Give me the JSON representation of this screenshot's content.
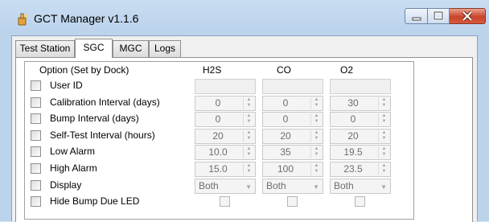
{
  "window": {
    "title": "GCT Manager v1.1.6"
  },
  "tabs": [
    "Test Station",
    "SGC",
    "MGC",
    "Logs"
  ],
  "active_tab": "SGC",
  "table": {
    "option_header": "Option (Set by Dock)",
    "columns": [
      "H2S",
      "CO",
      "O2"
    ],
    "rows": [
      {
        "label": "User ID",
        "type": "blank",
        "values": [
          "",
          "",
          ""
        ]
      },
      {
        "label": "Calibration Interval (days)",
        "type": "spin",
        "values": [
          "0",
          "0",
          "30"
        ]
      },
      {
        "label": "Bump Interval (days)",
        "type": "spin",
        "values": [
          "0",
          "0",
          "0"
        ]
      },
      {
        "label": "Self-Test Interval (hours)",
        "type": "spin",
        "values": [
          "20",
          "20",
          "20"
        ]
      },
      {
        "label": "Low Alarm",
        "type": "spin",
        "values": [
          "10.0",
          "35",
          "19.5"
        ]
      },
      {
        "label": "High Alarm",
        "type": "spin",
        "values": [
          "15.0",
          "100",
          "23.5"
        ]
      },
      {
        "label": "Display",
        "type": "combo",
        "values": [
          "Both",
          "Both",
          "Both"
        ]
      },
      {
        "label": "Hide Bump Due LED",
        "type": "check",
        "values": [
          "",
          "",
          ""
        ]
      }
    ]
  },
  "colors": {
    "title_bg": "#c9ddf1",
    "close_button": "#c8442a",
    "disabled_text": "#6d6d6d"
  }
}
